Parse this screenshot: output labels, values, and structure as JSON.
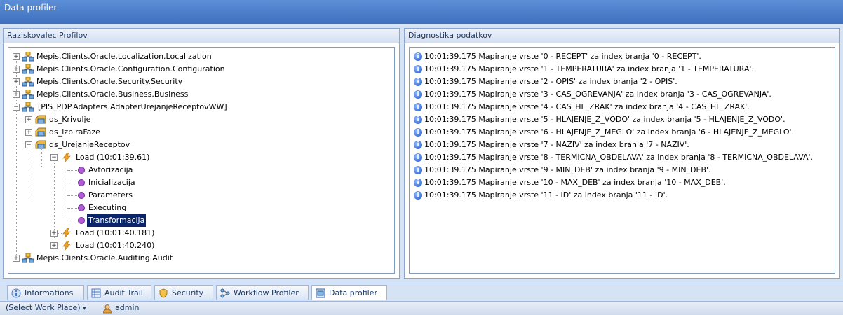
{
  "window": {
    "title": "Data profiler"
  },
  "left_panel": {
    "title": "Raziskovalec Profilov",
    "tree": [
      {
        "label": "Mepis.Clients.Oracle.Localization.Localization"
      },
      {
        "label": "Mepis.Clients.Oracle.Configuration.Configuration"
      },
      {
        "label": "Mepis.Clients.Oracle.Security.Security"
      },
      {
        "label": "Mepis.Clients.Oracle.Business.Business"
      },
      {
        "label": "[PIS_PDP.Adapters.AdapterUrejanjeReceptovWW]"
      },
      {
        "label": "ds_Krivulje"
      },
      {
        "label": "ds_izbiraFaze"
      },
      {
        "label": "ds_UrejanjeReceptov"
      },
      {
        "label": "Load (10:01:39.61)"
      },
      {
        "label": "Avtorizacija"
      },
      {
        "label": "Inicializacija"
      },
      {
        "label": "Parameters"
      },
      {
        "label": "Executing"
      },
      {
        "label": "Transformacija"
      },
      {
        "label": "Load (10:01:40.181)"
      },
      {
        "label": "Load (10:01:40.240)"
      },
      {
        "label": "Mepis.Clients.Oracle.Auditing.Audit"
      }
    ]
  },
  "right_panel": {
    "title": "Diagnostika podatkov",
    "log": [
      "10:01:39.175 Mapiranje vrste '0 - RECEPT' za index branja '0 - RECEPT'.",
      "10:01:39.175 Mapiranje vrste '1 - TEMPERATURA' za index branja '1 - TEMPERATURA'.",
      "10:01:39.175 Mapiranje vrste '2 - OPIS' za index branja '2 - OPIS'.",
      "10:01:39.175 Mapiranje vrste '3 - CAS_OGREVANJA' za index branja '3 - CAS_OGREVANJA'.",
      "10:01:39.175 Mapiranje vrste '4 - CAS_HL_ZRAK' za index branja '4 - CAS_HL_ZRAK'.",
      "10:01:39.175 Mapiranje vrste '5 - HLAJENJE_Z_VODO' za index branja '5 - HLAJENJE_Z_VODO'.",
      "10:01:39.175 Mapiranje vrste '6 - HLAJENJE_Z_MEGLO' za index branja '6 - HLAJENJE_Z_MEGLO'.",
      "10:01:39.175 Mapiranje vrste '7 - NAZIV' za index branja '7 - NAZIV'.",
      "10:01:39.175 Mapiranje vrste '8 - TERMICNA_OBDELAVA' za index branja '8 - TERMICNA_OBDELAVA'.",
      "10:01:39.175 Mapiranje vrste '9 - MIN_DEB' za index branja '9 - MIN_DEB'.",
      "10:01:39.175 Mapiranje vrste '10 - MAX_DEB' za index branja '10 - MAX_DEB'.",
      "10:01:39.175 Mapiranje vrste '11 - ID' za index branja '11 - ID'."
    ]
  },
  "tabs": [
    {
      "label": "Informations"
    },
    {
      "label": "Audit Trail"
    },
    {
      "label": "Security"
    },
    {
      "label": "Workflow Profiler"
    },
    {
      "label": "Data profiler"
    }
  ],
  "status_bar": {
    "workplace": "(Select Work Place)",
    "user": "admin"
  }
}
